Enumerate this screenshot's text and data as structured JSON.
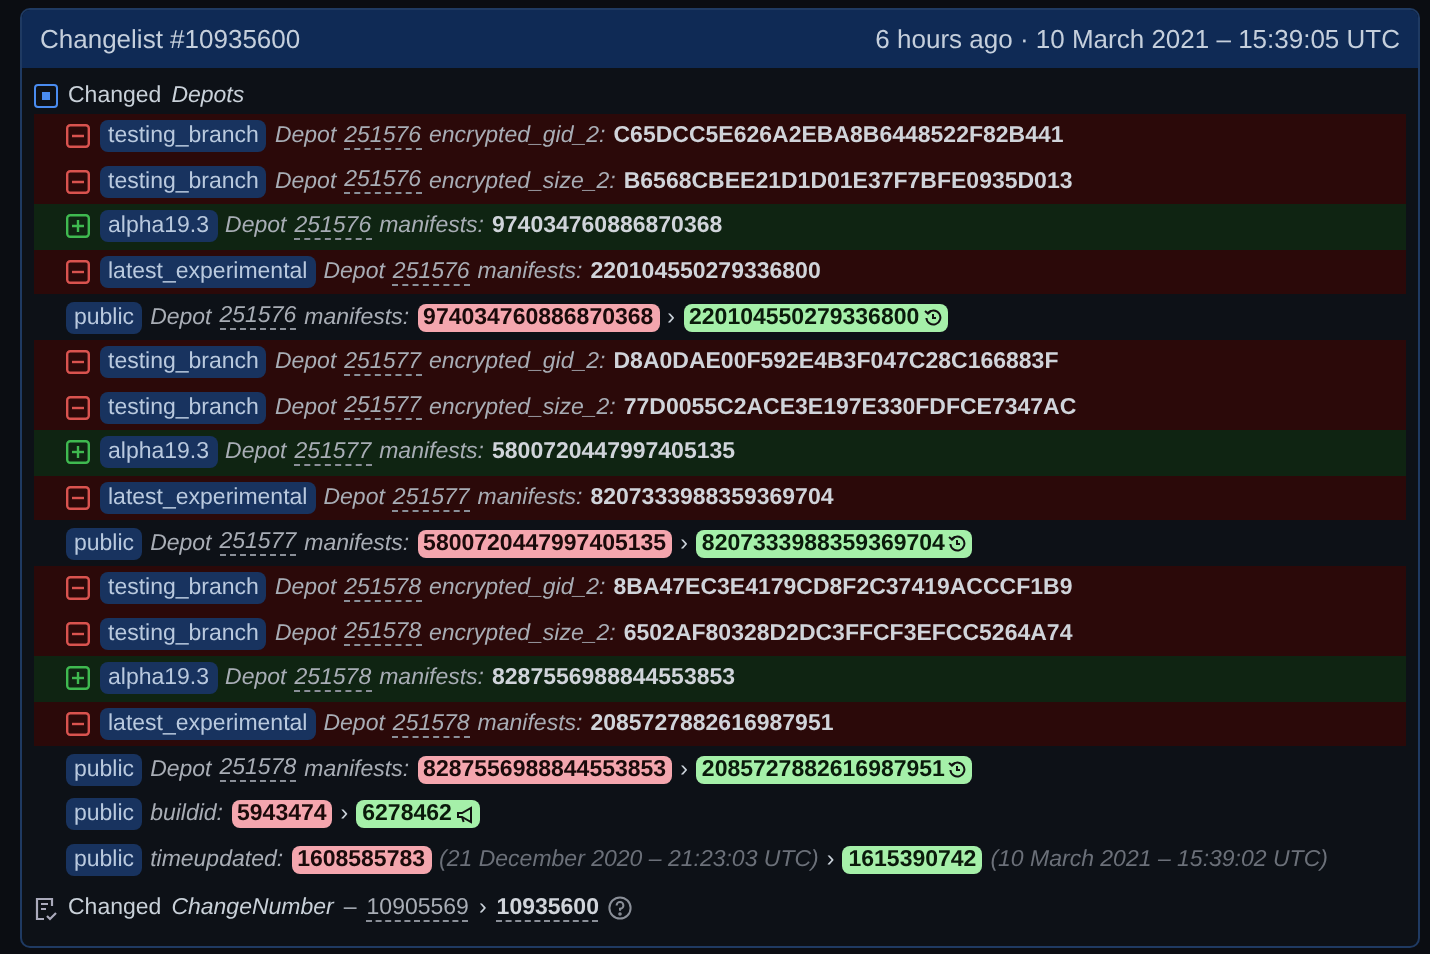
{
  "header": {
    "title": "Changelist #10935600",
    "time": "6 hours ago · 10 March 2021 – 15:39:05 UTC"
  },
  "section": {
    "label": "Changed",
    "subject": "Depots"
  },
  "rows": [
    {
      "kind": "removed",
      "branch": "testing_branch",
      "prefix": "Depot",
      "depot": "251576",
      "key": "encrypted_gid_2:",
      "value": "C65DCC5E626A2EBA8B6448522F82B441"
    },
    {
      "kind": "removed",
      "branch": "testing_branch",
      "prefix": "Depot",
      "depot": "251576",
      "key": "encrypted_size_2:",
      "value": "B6568CBEE21D1D01E37F7BFE0935D013"
    },
    {
      "kind": "added",
      "branch": "alpha19.3",
      "prefix": "Depot",
      "depot": "251576",
      "key": "manifests:",
      "value": "974034760886870368"
    },
    {
      "kind": "removed",
      "branch": "latest_experimental",
      "prefix": "Depot",
      "depot": "251576",
      "key": "manifests:",
      "value": "220104550279336800"
    },
    {
      "kind": "changed",
      "branch": "public",
      "prefix": "Depot",
      "depot": "251576",
      "key": "manifests:",
      "old": "974034760886870368",
      "separator": "›",
      "new": "220104550279336800"
    },
    {
      "kind": "removed",
      "branch": "testing_branch",
      "prefix": "Depot",
      "depot": "251577",
      "key": "encrypted_gid_2:",
      "value": "D8A0DAE00F592E4B3F047C28C166883F"
    },
    {
      "kind": "removed",
      "branch": "testing_branch",
      "prefix": "Depot",
      "depot": "251577",
      "key": "encrypted_size_2:",
      "value": "77D0055C2ACE3E197E330FDFCE7347AC"
    },
    {
      "kind": "added",
      "branch": "alpha19.3",
      "prefix": "Depot",
      "depot": "251577",
      "key": "manifests:",
      "value": "5800720447997405135"
    },
    {
      "kind": "removed",
      "branch": "latest_experimental",
      "prefix": "Depot",
      "depot": "251577",
      "key": "manifests:",
      "value": "8207333988359369704"
    },
    {
      "kind": "changed",
      "branch": "public",
      "prefix": "Depot",
      "depot": "251577",
      "key": "manifests:",
      "old": "5800720447997405135",
      "separator": "›",
      "new": "8207333988359369704"
    },
    {
      "kind": "removed",
      "branch": "testing_branch",
      "prefix": "Depot",
      "depot": "251578",
      "key": "encrypted_gid_2:",
      "value": "8BA47EC3E4179CD8F2C37419ACCCF1B9"
    },
    {
      "kind": "removed",
      "branch": "testing_branch",
      "prefix": "Depot",
      "depot": "251578",
      "key": "encrypted_size_2:",
      "value": "6502AF80328D2DC3FFCF3EFCC5264A74"
    },
    {
      "kind": "added",
      "branch": "alpha19.3",
      "prefix": "Depot",
      "depot": "251578",
      "key": "manifests:",
      "value": "8287556988844553853"
    },
    {
      "kind": "removed",
      "branch": "latest_experimental",
      "prefix": "Depot",
      "depot": "251578",
      "key": "manifests:",
      "value": "2085727882616987951"
    },
    {
      "kind": "changed",
      "branch": "public",
      "prefix": "Depot",
      "depot": "251578",
      "key": "manifests:",
      "old": "8287556988844553853",
      "separator": "›",
      "new": "2085727882616987951"
    },
    {
      "kind": "changed",
      "branch": "public",
      "key": "buildid:",
      "old": "5943474",
      "separator": "›",
      "new": "6278462"
    },
    {
      "kind": "changed",
      "branch": "public",
      "key": "timeupdated:",
      "old": "1608585783",
      "old_note": "(21 December 2020 – 21:23:03 UTC)",
      "separator": "›",
      "new": "1615390742",
      "new_note": "(10 March 2021 – 15:39:02 UTC)"
    }
  ],
  "footer": {
    "label": "Changed",
    "subject": "ChangeNumber",
    "dash": "–",
    "old": "10905569",
    "separator": "›",
    "new": "10935600"
  }
}
